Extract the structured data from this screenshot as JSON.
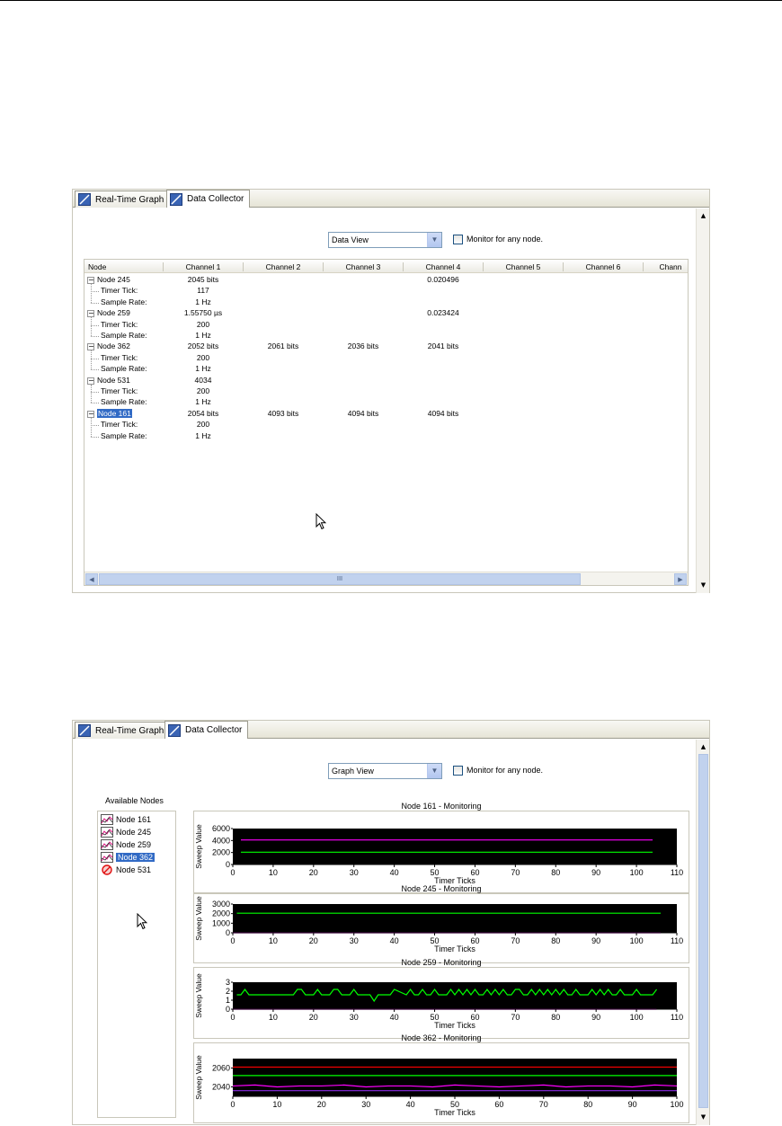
{
  "colors": {
    "accent": "#316ac5",
    "plot_bg": "#000000",
    "series_green": "#00ff00",
    "series_magenta": "#ff00ff",
    "series_red": "#ff0000",
    "series_purple": "#8a2be2"
  },
  "tabs": {
    "real_time_graph": "Real-Time Graph",
    "data_collector": "Data Collector"
  },
  "window1": {
    "view_select": "Data View",
    "monitor_label": "Monitor for any node.",
    "columns": [
      "Node",
      "Channel 1",
      "Channel 2",
      "Channel 3",
      "Channel 4",
      "Channel 5",
      "Channel 6",
      "Chann"
    ],
    "rows": [
      {
        "node": "Node 245",
        "ch1": "2045 bits",
        "ch2": "",
        "ch3": "",
        "ch4": "0.020496",
        "tick": "117",
        "rate": "1 Hz"
      },
      {
        "node": "Node 259",
        "ch1": "1.55750 µs",
        "ch2": "",
        "ch3": "",
        "ch4": "0.023424",
        "tick": "200",
        "rate": "1 Hz"
      },
      {
        "node": "Node 362",
        "ch1": "2052 bits",
        "ch2": "2061 bits",
        "ch3": "2036 bits",
        "ch4": "2041 bits",
        "tick": "200",
        "rate": "1 Hz"
      },
      {
        "node": "Node 531",
        "ch1": "4034",
        "ch2": "",
        "ch3": "",
        "ch4": "",
        "tick": "200",
        "rate": "1 Hz"
      },
      {
        "node": "Node 161",
        "ch1": "2054 bits",
        "ch2": "4093 bits",
        "ch3": "4094 bits",
        "ch4": "4094 bits",
        "tick": "200",
        "rate": "1 Hz"
      }
    ],
    "timer_tick_label": "Timer Tick:",
    "sample_rate_label": "Sample Rate:",
    "hscroll_grip": "III"
  },
  "window2": {
    "view_select": "Graph View",
    "monitor_label": "Monitor for any node.",
    "available_nodes_title": "Available Nodes",
    "available_nodes": [
      "Node 161",
      "Node 245",
      "Node 259",
      "Node 362",
      "Node 531"
    ],
    "selected_node": "Node 362",
    "disabled_node": "Node 531"
  },
  "chart_data": [
    {
      "type": "line",
      "title": "Node 161 - Monitoring",
      "xlabel": "Timer Ticks",
      "ylabel": "Sweep Value",
      "xlim": [
        0,
        110
      ],
      "ylim": [
        0,
        6000
      ],
      "xticks": [
        "0",
        "10",
        "20",
        "30",
        "40",
        "50",
        "60",
        "70",
        "80",
        "90",
        "100",
        "110"
      ],
      "yticks": [
        "0",
        "2000",
        "4000",
        "6000"
      ],
      "series": [
        {
          "color": "#ff00ff",
          "x": [
            2,
            104
          ],
          "y": [
            4094,
            4094
          ]
        },
        {
          "color": "#00ff00",
          "x": [
            2,
            104
          ],
          "y": [
            2054,
            2054
          ]
        }
      ]
    },
    {
      "type": "line",
      "title": "Node 245 - Monitoring",
      "xlabel": "Timer Ticks",
      "ylabel": "Sweep Value",
      "xlim": [
        0,
        110
      ],
      "ylim": [
        0,
        3000
      ],
      "xticks": [
        "0",
        "10",
        "20",
        "30",
        "40",
        "50",
        "60",
        "70",
        "80",
        "90",
        "100",
        "110"
      ],
      "yticks": [
        "0",
        "1000",
        "2000",
        "3000"
      ],
      "series": [
        {
          "color": "#00ff00",
          "x": [
            1,
            106
          ],
          "y": [
            2045,
            2045
          ]
        },
        {
          "color": "#ff00ff",
          "x": [
            0,
            106
          ],
          "y": [
            0,
            0
          ]
        }
      ]
    },
    {
      "type": "line",
      "title": "Node 259 - Monitoring",
      "xlabel": "Timer Ticks",
      "ylabel": "Sweep Value",
      "xlim": [
        0,
        110
      ],
      "ylim": [
        0,
        3
      ],
      "xticks": [
        "0",
        "10",
        "20",
        "30",
        "40",
        "50",
        "60",
        "70",
        "80",
        "90",
        "100",
        "110"
      ],
      "yticks": [
        "0",
        "1",
        "2",
        "3"
      ],
      "series": [
        {
          "color": "#00ff00",
          "x": [
            1,
            2,
            3,
            4,
            15,
            16,
            17,
            18,
            20,
            21,
            22,
            23,
            24,
            25,
            26,
            27,
            28,
            29,
            30,
            31,
            32,
            33,
            34,
            35,
            36,
            37,
            38,
            39,
            40,
            43,
            44,
            45,
            46,
            47,
            48,
            49,
            50,
            51,
            52,
            53,
            54,
            55,
            56,
            57,
            58,
            59,
            60,
            61,
            62,
            63,
            64,
            65,
            66,
            67,
            68,
            69,
            70,
            71,
            72,
            73,
            74,
            75,
            76,
            77,
            78,
            79,
            80,
            81,
            82,
            83,
            84,
            85,
            86,
            87,
            88,
            89,
            90,
            91,
            92,
            93,
            94,
            95,
            96,
            97,
            98,
            99,
            100,
            101,
            102,
            103,
            104,
            105
          ],
          "y": [
            1.6,
            1.6,
            2.2,
            1.6,
            1.6,
            2.2,
            2.2,
            1.6,
            1.6,
            2.2,
            1.6,
            1.6,
            1.6,
            2.2,
            2.2,
            1.6,
            1.6,
            1.6,
            2.2,
            1.6,
            1.6,
            1.6,
            1.6,
            0.9,
            1.6,
            1.6,
            1.6,
            1.6,
            2.2,
            1.6,
            2.2,
            1.6,
            1.6,
            2.2,
            1.6,
            1.6,
            2.2,
            1.6,
            1.6,
            1.6,
            2.2,
            1.6,
            2.2,
            1.6,
            2.2,
            1.6,
            2.2,
            1.6,
            1.6,
            2.2,
            1.6,
            2.2,
            1.6,
            2.2,
            1.6,
            1.6,
            2.2,
            2.2,
            1.6,
            1.6,
            2.2,
            1.6,
            2.2,
            1.6,
            2.2,
            1.6,
            2.2,
            1.6,
            2.2,
            1.6,
            1.6,
            2.2,
            1.6,
            1.6,
            1.6,
            2.2,
            1.6,
            2.2,
            1.6,
            2.2,
            1.6,
            1.6,
            2.2,
            1.6,
            1.6,
            1.6,
            2.2,
            1.6,
            1.6,
            1.6,
            1.6,
            2.2
          ]
        },
        {
          "color": "#ff00ff",
          "x": [
            0,
            105
          ],
          "y": [
            0,
            0
          ]
        }
      ]
    },
    {
      "type": "line",
      "title": "Node 362 - Monitoring",
      "xlabel": "Timer Ticks",
      "ylabel": "Sweep Value",
      "xlim": [
        0,
        100
      ],
      "ylim": [
        2030,
        2070
      ],
      "xticks": [
        "0",
        "10",
        "20",
        "30",
        "40",
        "50",
        "60",
        "70",
        "80",
        "90",
        "100"
      ],
      "yticks": [
        "2040",
        "2060"
      ],
      "series": [
        {
          "color": "#ff0000",
          "x": [
            0,
            100
          ],
          "y": [
            2061,
            2061
          ]
        },
        {
          "color": "#00ff00",
          "x": [
            0,
            100
          ],
          "y": [
            2052,
            2052
          ]
        },
        {
          "color": "#ff00ff",
          "x": [
            0,
            5,
            10,
            15,
            20,
            25,
            30,
            35,
            40,
            45,
            50,
            55,
            60,
            65,
            70,
            75,
            80,
            85,
            90,
            95,
            100
          ],
          "y": [
            2041,
            2042,
            2040,
            2041,
            2041,
            2042,
            2040,
            2041,
            2041,
            2040,
            2042,
            2041,
            2040,
            2041,
            2042,
            2040,
            2041,
            2041,
            2040,
            2042,
            2041
          ]
        },
        {
          "color": "#8a2be2",
          "x": [
            0,
            100
          ],
          "y": [
            2036,
            2036
          ]
        }
      ]
    }
  ]
}
